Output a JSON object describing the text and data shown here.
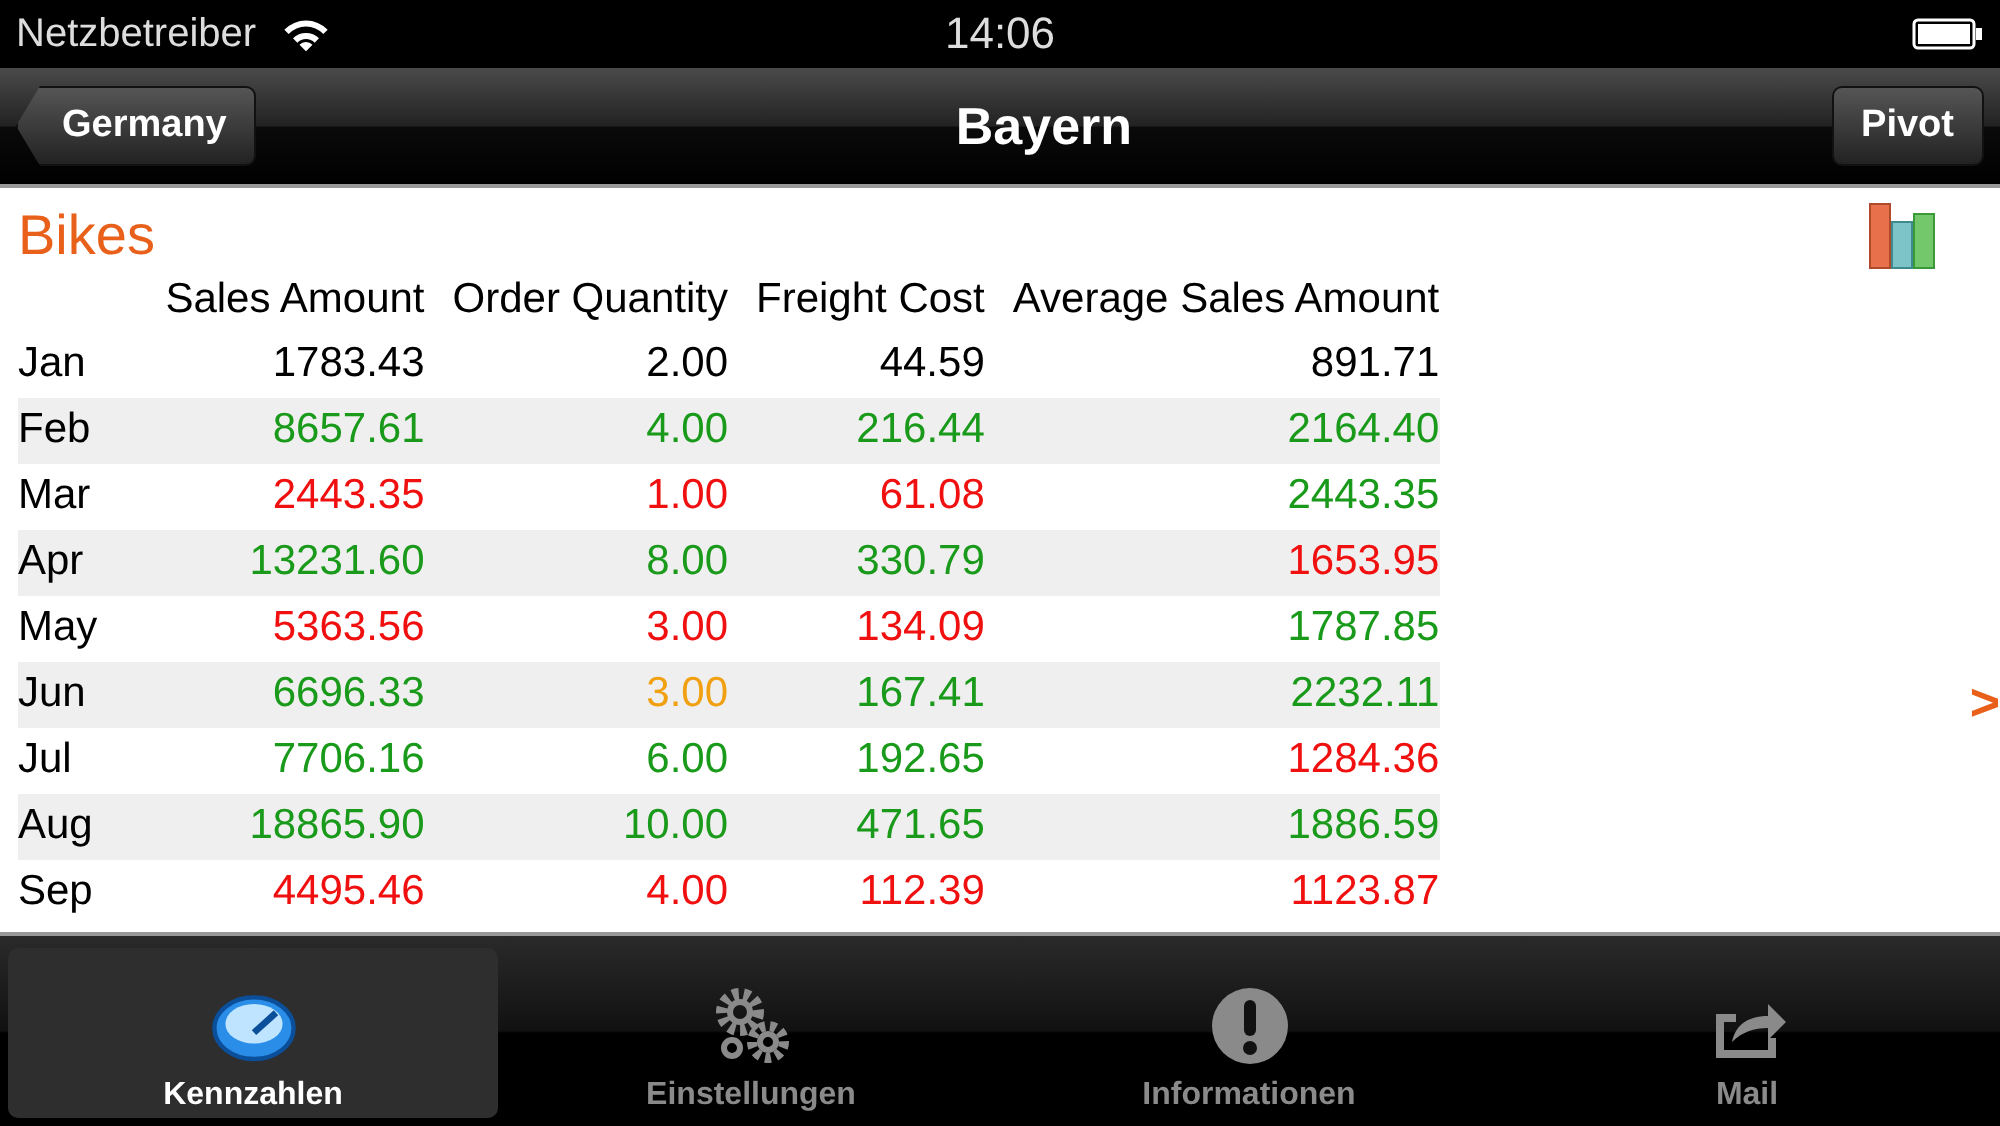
{
  "status_bar": {
    "carrier": "Netzbetreiber",
    "time": "14:06"
  },
  "nav": {
    "back": "Germany",
    "title": "Bayern",
    "action": "Pivot"
  },
  "section": {
    "title": "Bikes"
  },
  "table": {
    "columns": [
      "Sales Amount",
      "Order Quantity",
      "Freight Cost",
      "Average Sales Amount"
    ],
    "rows": [
      {
        "label": "Jan",
        "cells": [
          {
            "text": "1783.43",
            "color": "#000000"
          },
          {
            "text": "2.00",
            "color": "#000000"
          },
          {
            "text": "44.59",
            "color": "#000000"
          },
          {
            "text": "891.71",
            "color": "#000000"
          }
        ]
      },
      {
        "label": "Feb",
        "cells": [
          {
            "text": "8657.61",
            "color": "#1a9a1a"
          },
          {
            "text": "4.00",
            "color": "#1a9a1a"
          },
          {
            "text": "216.44",
            "color": "#1a9a1a"
          },
          {
            "text": "2164.40",
            "color": "#1a9a1a"
          }
        ]
      },
      {
        "label": "Mar",
        "cells": [
          {
            "text": "2443.35",
            "color": "#f01010"
          },
          {
            "text": "1.00",
            "color": "#f01010"
          },
          {
            "text": "61.08",
            "color": "#f01010"
          },
          {
            "text": "2443.35",
            "color": "#1a9a1a"
          }
        ]
      },
      {
        "label": "Apr",
        "cells": [
          {
            "text": "13231.60",
            "color": "#1a9a1a"
          },
          {
            "text": "8.00",
            "color": "#1a9a1a"
          },
          {
            "text": "330.79",
            "color": "#1a9a1a"
          },
          {
            "text": "1653.95",
            "color": "#f01010"
          }
        ]
      },
      {
        "label": "May",
        "cells": [
          {
            "text": "5363.56",
            "color": "#f01010"
          },
          {
            "text": "3.00",
            "color": "#f01010"
          },
          {
            "text": "134.09",
            "color": "#f01010"
          },
          {
            "text": "1787.85",
            "color": "#1a9a1a"
          }
        ]
      },
      {
        "label": "Jun",
        "cells": [
          {
            "text": "6696.33",
            "color": "#1a9a1a"
          },
          {
            "text": "3.00",
            "color": "#f0a010"
          },
          {
            "text": "167.41",
            "color": "#1a9a1a"
          },
          {
            "text": "2232.11",
            "color": "#1a9a1a"
          }
        ]
      },
      {
        "label": "Jul",
        "cells": [
          {
            "text": "7706.16",
            "color": "#1a9a1a"
          },
          {
            "text": "6.00",
            "color": "#1a9a1a"
          },
          {
            "text": "192.65",
            "color": "#1a9a1a"
          },
          {
            "text": "1284.36",
            "color": "#f01010"
          }
        ]
      },
      {
        "label": "Aug",
        "cells": [
          {
            "text": "18865.90",
            "color": "#1a9a1a"
          },
          {
            "text": "10.00",
            "color": "#1a9a1a"
          },
          {
            "text": "471.65",
            "color": "#1a9a1a"
          },
          {
            "text": "1886.59",
            "color": "#1a9a1a"
          }
        ]
      },
      {
        "label": "Sep",
        "cells": [
          {
            "text": "4495.46",
            "color": "#f01010"
          },
          {
            "text": "4.00",
            "color": "#f01010"
          },
          {
            "text": "112.39",
            "color": "#f01010"
          },
          {
            "text": "1123.87",
            "color": "#f01010"
          }
        ]
      }
    ]
  },
  "next_arrow": ">",
  "tab_bar": [
    {
      "label": "Kennzahlen",
      "kind": "gauge",
      "selected": true
    },
    {
      "label": "Einstellungen",
      "kind": "gears",
      "selected": false
    },
    {
      "label": "Informationen",
      "kind": "info",
      "selected": false
    },
    {
      "label": "Mail",
      "kind": "share",
      "selected": false
    }
  ]
}
